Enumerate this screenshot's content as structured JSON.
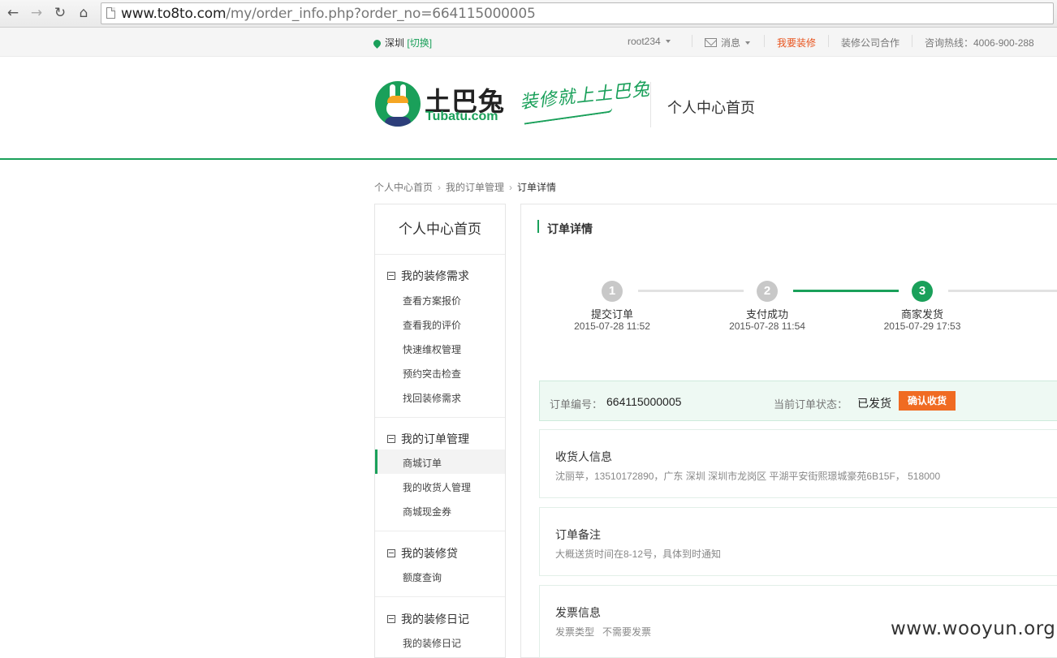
{
  "browser": {
    "url_host": "www.to8to.com",
    "url_path": "/my/order_info.php?order_no=664115000005"
  },
  "topbar": {
    "city": "深圳",
    "switch_label": "[切换]",
    "user": "root234",
    "messages": "消息",
    "renovate": "我要装修",
    "cooperate": "装修公司合作",
    "hotline": "咨询热线：4006-900-288"
  },
  "header": {
    "brand_cn": "土巴兔",
    "brand_en": "Tubatu.com",
    "slogan": "装修就上土巴兔",
    "title": "个人中心首页"
  },
  "breadcrumb": [
    "个人中心首页",
    "我的订单管理",
    "订单详情"
  ],
  "sidebar": {
    "title": "个人中心首页",
    "groups": [
      {
        "title": "我的装修需求",
        "items": [
          "查看方案报价",
          "查看我的评价",
          "快速维权管理",
          "预约突击检查",
          "找回装修需求"
        ]
      },
      {
        "title": "我的订单管理",
        "items": [
          "商城订单",
          "我的收货人管理",
          "商城现金券"
        ]
      },
      {
        "title": "我的装修贷",
        "items": [
          "额度查询"
        ]
      },
      {
        "title": "我的装修日记",
        "items": [
          "我的装修日记"
        ]
      }
    ],
    "active_item": "商城订单"
  },
  "main": {
    "title": "订单详情",
    "steps": [
      {
        "num": "1",
        "label": "提交订单",
        "time": "2015-07-28 11:52",
        "state": "done"
      },
      {
        "num": "2",
        "label": "支付成功",
        "time": "2015-07-28 11:54",
        "state": "done"
      },
      {
        "num": "3",
        "label": "商家发货",
        "time": "2015-07-29 17:53",
        "state": "current"
      }
    ],
    "order_no_label": "订单编号：",
    "order_no": "664115000005",
    "state_label": "当前订单状态：",
    "state": "已发货",
    "confirm_button": "确认收货",
    "receiver": {
      "title": "收货人信息",
      "text": "沈丽苹，13510172890，广东 深圳 深圳市龙岗区 平湖平安街熙璟城豪苑6B15F， 518000"
    },
    "remark": {
      "title": "订单备注",
      "text": "大概送货时间在8-12号，具体到时通知"
    },
    "invoice": {
      "title": "发票信息",
      "type_label": "发票类型",
      "type_value": "不需要发票"
    }
  },
  "watermark": "www.wooyun.org",
  "colors": {
    "brand_green": "#1aa05a",
    "accent_orange": "#f06b22",
    "step_gray": "#c8c8c8"
  }
}
